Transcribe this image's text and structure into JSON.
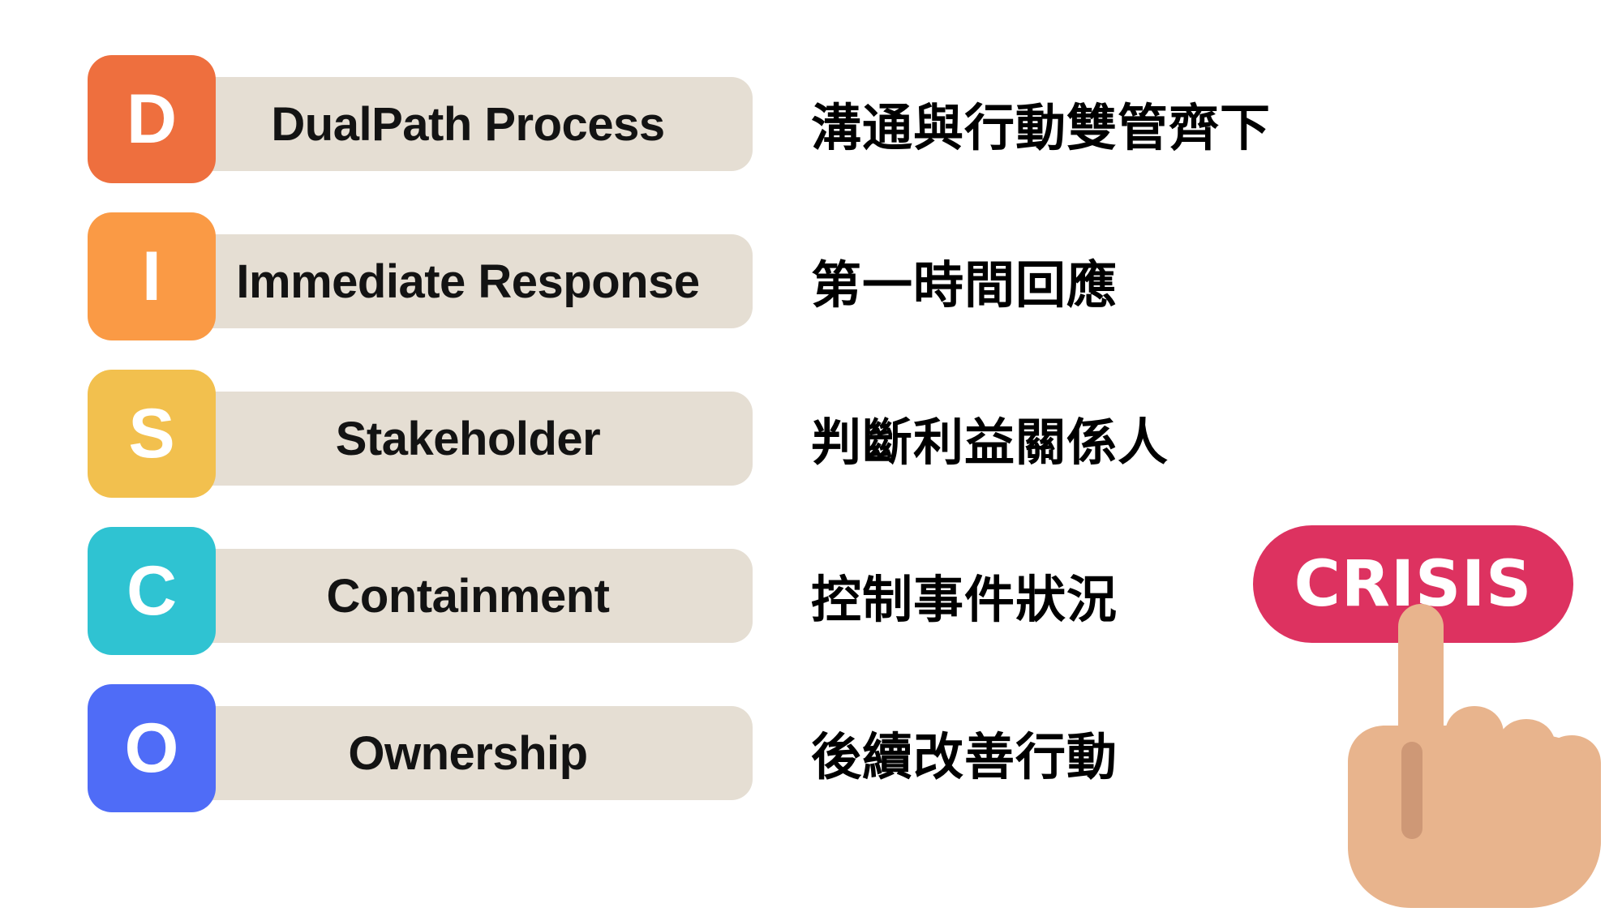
{
  "page": {
    "background_color": "#FFFFFF",
    "bar_color": "#E5DED3",
    "text_color": "#131313"
  },
  "rows": [
    {
      "letter": "D",
      "title": "DualPath Process",
      "description": "溝通與行動雙管齊下",
      "tile_color": "#EE6F3E",
      "accent_color": "#F5A884"
    },
    {
      "letter": "I",
      "title": "Immediate Response",
      "description": "第一時間回應",
      "tile_color": "#FA9A45",
      "accent_color": "#FCC893"
    },
    {
      "letter": "S",
      "title": "Stakeholder",
      "description": "判斷利益關係人",
      "tile_color": "#F2C04E",
      "accent_color": "#F7DB9A"
    },
    {
      "letter": "C",
      "title": "Containment",
      "description": "控制事件狀況",
      "tile_color": "#2FC3D2",
      "accent_color": "#93E0EA"
    },
    {
      "letter": "O",
      "title": "Ownership",
      "description": "後續改善行動",
      "tile_color": "#4F6CF7",
      "accent_color": "#A6B5FB"
    }
  ],
  "crisis": {
    "label": "CRISIS",
    "button_color": "#DD3260",
    "label_color": "#FFFFFF",
    "hand_skin_color": "#E8B48D",
    "hand_shadow_color": "#CE9876"
  }
}
